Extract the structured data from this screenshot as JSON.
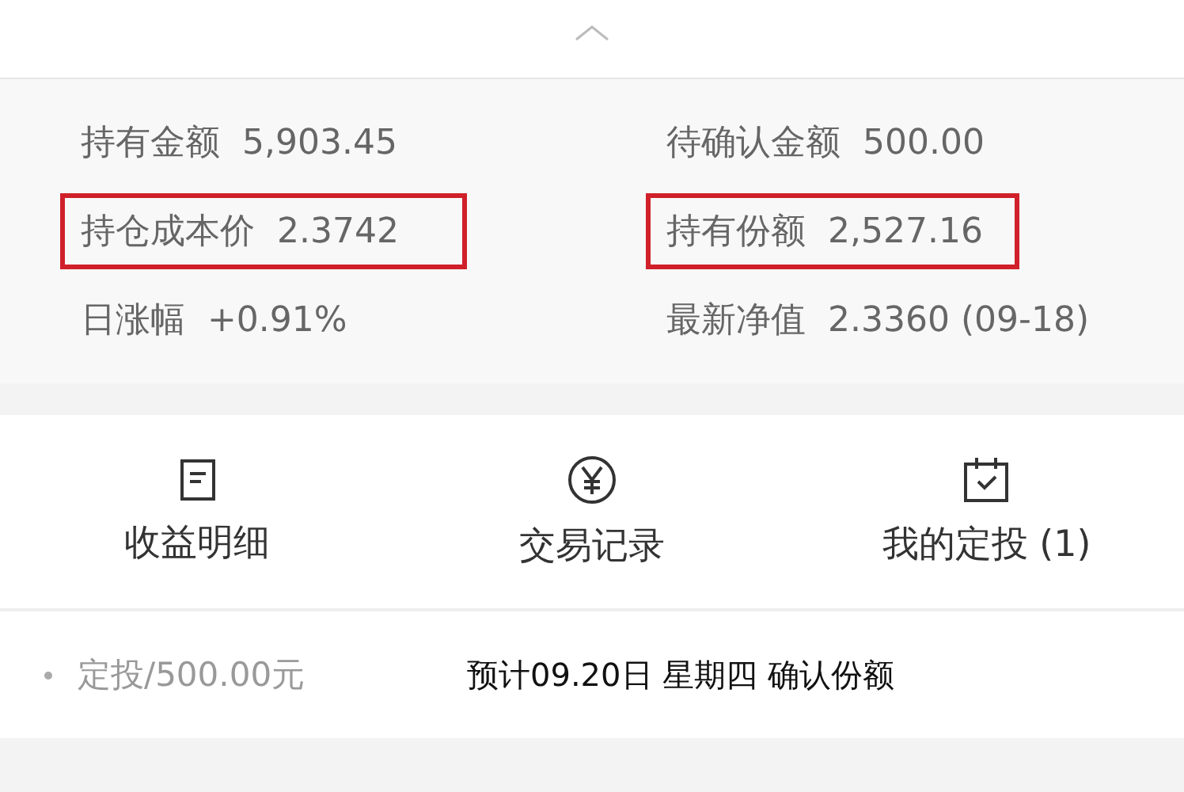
{
  "stats": [
    {
      "label": "持有金额",
      "value": "5,903.45",
      "highlighted": false
    },
    {
      "label": "待确认金额",
      "value": "500.00",
      "highlighted": false
    },
    {
      "label": "持仓成本价",
      "value": "2.3742",
      "highlighted": true
    },
    {
      "label": "持有份额",
      "value": "2,527.16",
      "highlighted": true
    },
    {
      "label": "日涨幅",
      "value": "+0.91%",
      "highlighted": false
    },
    {
      "label": "最新净值",
      "value": "2.3360 (09-18)",
      "highlighted": false
    }
  ],
  "actions": [
    {
      "label": "收益明细",
      "kind": "document"
    },
    {
      "label": "交易记录",
      "kind": "yuan"
    },
    {
      "label": "我的定投 (1)",
      "kind": "calendar"
    }
  ],
  "plan": {
    "amount": "定投/500.00元",
    "note": "预计09.20日 星期四 确认份额"
  }
}
